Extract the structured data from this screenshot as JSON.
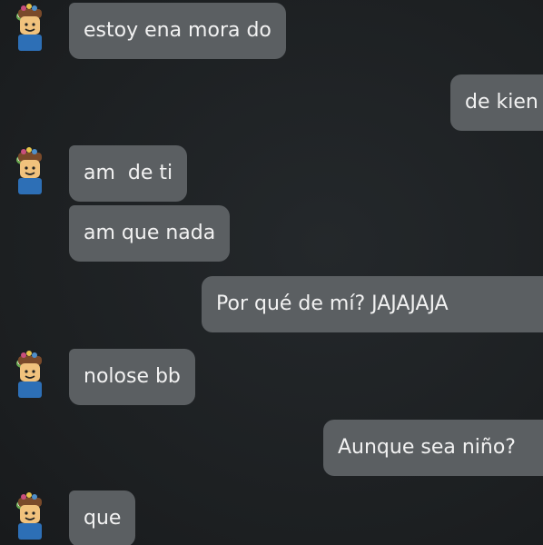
{
  "contact": {
    "avatar_icon": "roblox-avatar-icon"
  },
  "messages": [
    {
      "sender": "them",
      "text": "estoy ena mora do"
    },
    {
      "sender": "me",
      "text": "de kien"
    },
    {
      "sender": "them",
      "text": "am  de ti"
    },
    {
      "sender": "them",
      "text": "am que nada"
    },
    {
      "sender": "me",
      "text": "Por qué de mí? JAJAJAJA"
    },
    {
      "sender": "them",
      "text": "nolose bb"
    },
    {
      "sender": "me",
      "text": "Aunque sea niño?"
    },
    {
      "sender": "them",
      "text": "que"
    }
  ],
  "colors": {
    "background": "#1d2022",
    "bubble": "#5b5f62",
    "text": "#f2f2f2"
  }
}
